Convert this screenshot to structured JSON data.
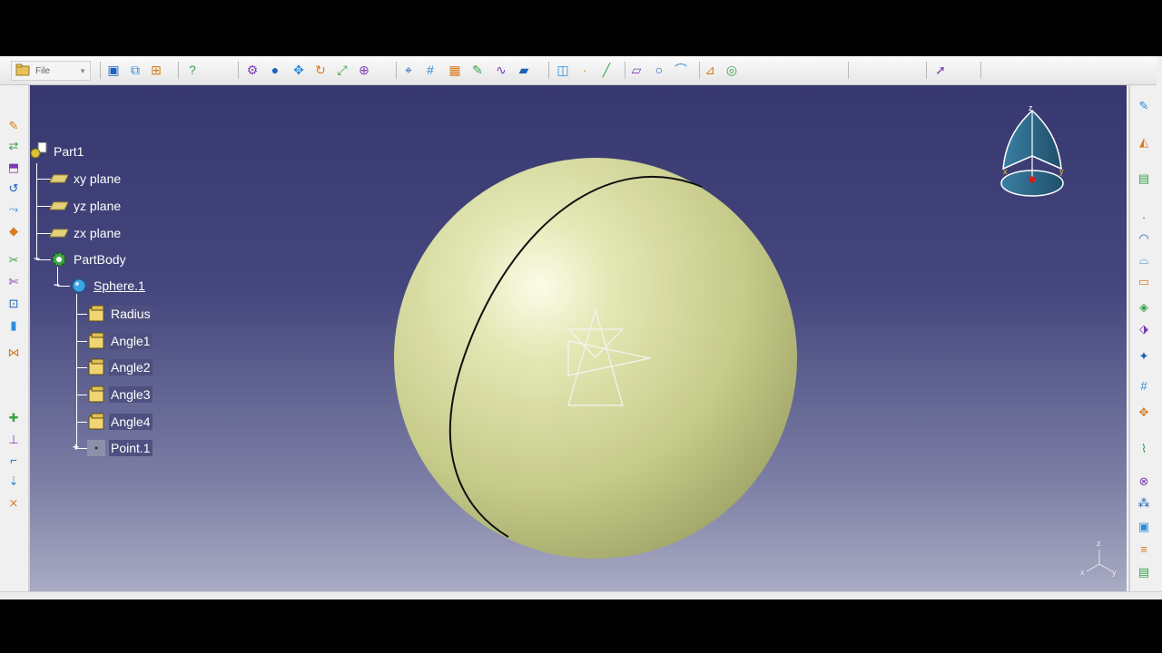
{
  "toolbar": {
    "file_label": "File"
  },
  "tree": {
    "root": "Part1",
    "planes": [
      "xy plane",
      "yz plane",
      "zx plane"
    ],
    "body": "PartBody",
    "feature": "Sphere.1",
    "params": [
      "Radius",
      "Angle1",
      "Angle2",
      "Angle3",
      "Angle4"
    ],
    "point": "Point.1"
  },
  "compass": {
    "axis_z": "z",
    "axis_x": "x",
    "axis_y": "y"
  },
  "triad": {
    "z": "z",
    "x": "x",
    "y": "y"
  },
  "colors": {
    "viewport_top": "#37386f",
    "viewport_bottom": "#a9abc3",
    "sphere": "#d6dba0",
    "compass": "#2f6f8f"
  },
  "icons": {
    "toolbar": [
      "open-icon",
      "new-window-icon",
      "tile-icon",
      "help-icon",
      "catalog-icon",
      "sphere-view-icon",
      "pan-icon",
      "rotate-icon",
      "fit-all-icon",
      "zoom-icon",
      "normal-view-icon",
      "grid-icon",
      "select-icon",
      "sketch-icon",
      "curve-icon",
      "pad-icon",
      "pocket-icon",
      "point-icon",
      "line-icon",
      "plane-icon",
      "circle-icon",
      "spline-icon",
      "measure-icon",
      "analysis-icon",
      "arrow-select-icon"
    ],
    "left": [
      "edit-icon",
      "transform-icon",
      "extrude-icon",
      "revolve-icon",
      "sweep-icon",
      "fill-icon",
      "split-icon",
      "trim-icon",
      "offset-icon",
      "thicken-icon",
      "join-icon",
      "heal-icon",
      "axis-icon",
      "corner-icon",
      "project-icon",
      "intersect-icon"
    ],
    "right": [
      "sketcher-icon",
      "material-icon",
      "pdf-icon",
      "point-icon",
      "arc-icon",
      "surface-icon",
      "eraser-icon",
      "cube-icon",
      "cube-plus-icon",
      "render-icon",
      "grid-icon",
      "snap-icon",
      "curve-analysis-icon",
      "xyz-icon",
      "pattern-icon",
      "box-icon",
      "stack-icon",
      "layer-icon"
    ]
  }
}
